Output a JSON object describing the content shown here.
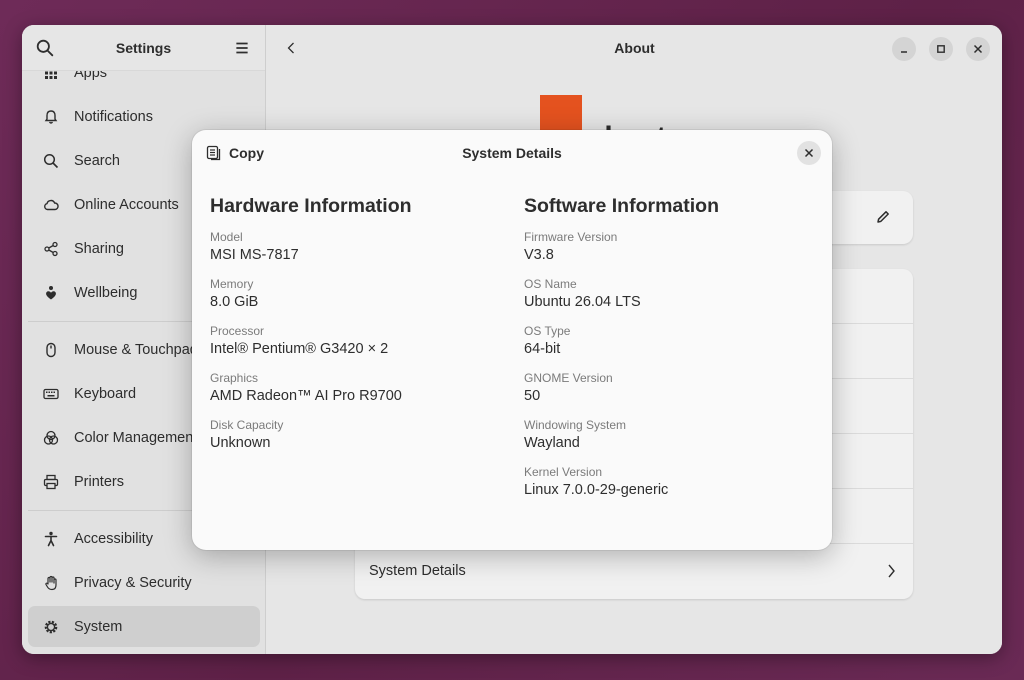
{
  "sidebar": {
    "title": "Settings",
    "items": [
      {
        "label": "Apps",
        "icon": "apps-grid-icon",
        "active": false
      },
      {
        "label": "Notifications",
        "icon": "bell-icon",
        "active": false
      },
      {
        "label": "Search",
        "icon": "search-icon",
        "active": false
      },
      {
        "label": "Online Accounts",
        "icon": "cloud-icon",
        "active": false
      },
      {
        "label": "Sharing",
        "icon": "share-icon",
        "active": false
      },
      {
        "label": "Wellbeing",
        "icon": "heart-person-icon",
        "active": false
      },
      {
        "label": "Mouse & Touchpad",
        "icon": "mouse-icon",
        "active": false
      },
      {
        "label": "Keyboard",
        "icon": "keyboard-icon",
        "active": false
      },
      {
        "label": "Color Management",
        "icon": "color-icon",
        "active": false
      },
      {
        "label": "Printers",
        "icon": "printer-icon",
        "active": false
      },
      {
        "label": "Accessibility",
        "icon": "accessibility-icon",
        "active": false
      },
      {
        "label": "Privacy & Security",
        "icon": "hand-icon",
        "active": false
      },
      {
        "label": "System",
        "icon": "gear-icon",
        "active": true
      }
    ]
  },
  "content": {
    "title": "About",
    "logo_text": "ubuntu",
    "system_details_label": "System Details"
  },
  "dialog": {
    "title": "System Details",
    "copy_label": "Copy",
    "hardware": {
      "heading": "Hardware Information",
      "fields": [
        {
          "label": "Model",
          "value": "MSI MS-7817"
        },
        {
          "label": "Memory",
          "value": "8.0 GiB"
        },
        {
          "label": "Processor",
          "value": "Intel® Pentium® G3420 × 2"
        },
        {
          "label": "Graphics",
          "value": "AMD Radeon™ AI Pro R9700"
        },
        {
          "label": "Disk Capacity",
          "value": "Unknown"
        }
      ]
    },
    "software": {
      "heading": "Software Information",
      "fields": [
        {
          "label": "Firmware Version",
          "value": "V3.8"
        },
        {
          "label": "OS Name",
          "value": "Ubuntu 26.04 LTS"
        },
        {
          "label": "OS Type",
          "value": "64-bit"
        },
        {
          "label": "GNOME Version",
          "value": "50"
        },
        {
          "label": "Windowing System",
          "value": "Wayland"
        },
        {
          "label": "Kernel Version",
          "value": "Linux 7.0.0-29-generic"
        }
      ]
    }
  },
  "colors": {
    "accent": "#e95420",
    "desktop": "#6b2a55",
    "window_bg": "#ebebeb",
    "dialog_bg": "#fafafa"
  }
}
